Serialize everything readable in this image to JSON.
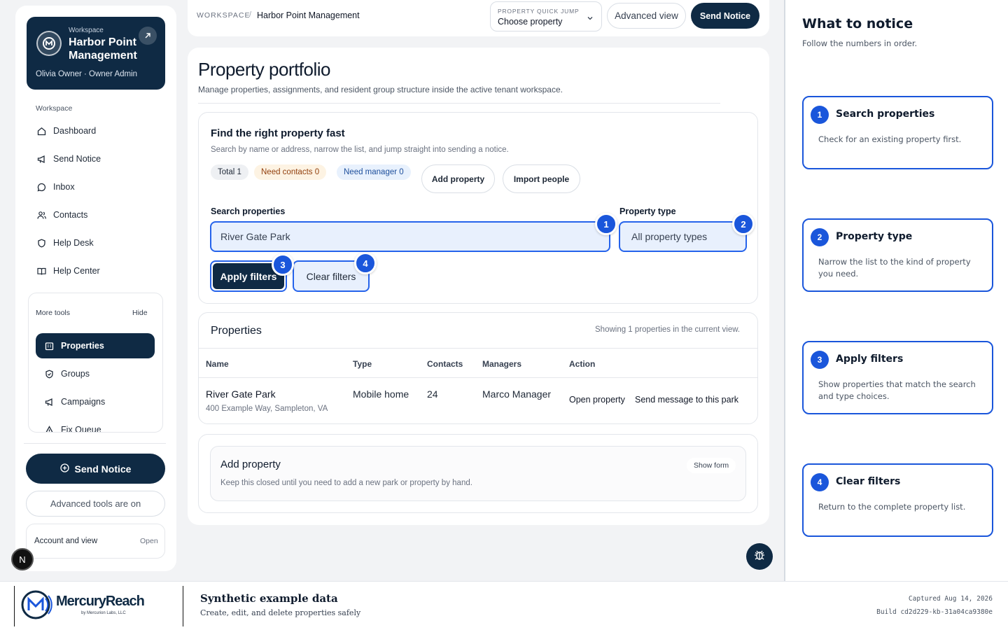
{
  "sidebar": {
    "workspace_label": "Workspace",
    "workspace_name": "Harbor Point Management",
    "user_line": "Olivia Owner · Owner Admin",
    "section_label": "Workspace",
    "nav": [
      {
        "label": "Dashboard",
        "icon": "home-icon"
      },
      {
        "label": "Send Notice",
        "icon": "megaphone-icon"
      },
      {
        "label": "Inbox",
        "icon": "chat-bubble-icon"
      },
      {
        "label": "Contacts",
        "icon": "people-icon"
      },
      {
        "label": "Help Desk",
        "icon": "shield-icon"
      },
      {
        "label": "Help Center",
        "icon": "book-icon"
      }
    ],
    "more_tools_label": "More tools",
    "hide_label": "Hide",
    "tools": [
      {
        "label": "Properties",
        "icon": "building-icon",
        "active": true
      },
      {
        "label": "Groups",
        "icon": "shield-check-icon"
      },
      {
        "label": "Campaigns",
        "icon": "megaphone-icon"
      },
      {
        "label": "Fix Queue",
        "icon": "warning-icon"
      }
    ],
    "send_notice_label": "Send Notice",
    "advanced_tools_label": "Advanced tools are on",
    "account_label": "Account and view",
    "account_open": "Open",
    "avatar_letter": "N"
  },
  "topbar": {
    "breadcrumb_root": "WORKSPACE",
    "breadcrumb_sep": "/",
    "breadcrumb_current": "Harbor Point Management",
    "quick_jump_label": "PROPERTY QUICK JUMP",
    "quick_jump_value": "Choose property",
    "advanced_view_label": "Advanced view",
    "send_notice_label": "Send Notice"
  },
  "page": {
    "title": "Property portfolio",
    "subtitle": "Manage properties, assignments, and resident group structure inside the active tenant workspace."
  },
  "finder": {
    "title": "Find the right property fast",
    "subtitle": "Search by name or address, narrow the list, and jump straight into sending a notice.",
    "pills": [
      {
        "label": "Total 1",
        "bg": "#eef0f3",
        "color": "#1f2937"
      },
      {
        "label": "Need contacts 0",
        "bg": "#fdf3e3",
        "color": "#92400e"
      },
      {
        "label": "Need manager 0",
        "bg": "#e8f1fd",
        "color": "#1e4f9c"
      }
    ],
    "add_property_label": "Add property",
    "import_people_label": "Import people",
    "search_label": "Search properties",
    "search_value": "River Gate Park",
    "type_label": "Property type",
    "type_value": "All property types",
    "apply_label": "Apply filters",
    "clear_label": "Clear filters",
    "badges": [
      "1",
      "2",
      "3",
      "4"
    ]
  },
  "properties": {
    "title": "Properties",
    "showing": "Showing 1 properties in the current view.",
    "columns": [
      "Name",
      "Type",
      "Contacts",
      "Managers",
      "Action"
    ],
    "rows": [
      {
        "name": "River Gate Park",
        "address": "400 Example Way, Sampleton, VA",
        "type": "Mobile home",
        "contacts": "24",
        "managers": "Marco Manager",
        "action_open": "Open property",
        "action_send": "Send message to this park"
      }
    ]
  },
  "add_property": {
    "title": "Add property",
    "desc": "Keep this closed until you need to add a new park or property by hand.",
    "show_form": "Show form"
  },
  "right_panel": {
    "title": "What to notice",
    "subtitle": "Follow the numbers in order.",
    "steps": [
      {
        "num": "1",
        "title": "Search properties",
        "desc": "Check for an existing property first."
      },
      {
        "num": "2",
        "title": "Property type",
        "desc": "Narrow the list to the kind of property you need."
      },
      {
        "num": "3",
        "title": "Apply filters",
        "desc": "Show properties that match the search and type choices."
      },
      {
        "num": "4",
        "title": "Clear filters",
        "desc": "Return to the complete property list."
      }
    ]
  },
  "footer": {
    "brand": "MercuryReach",
    "brand_sub": "by Mercurion Labs, LLC",
    "title": "Synthetic example data",
    "subtitle": "Create, edit, and delete properties safely",
    "captured": "Captured Aug 14, 2026",
    "build": "Build cd2d229-kb-31a04ca9380e"
  },
  "colors": {
    "navy": "#0f2a44",
    "accent": "#1a56db"
  }
}
